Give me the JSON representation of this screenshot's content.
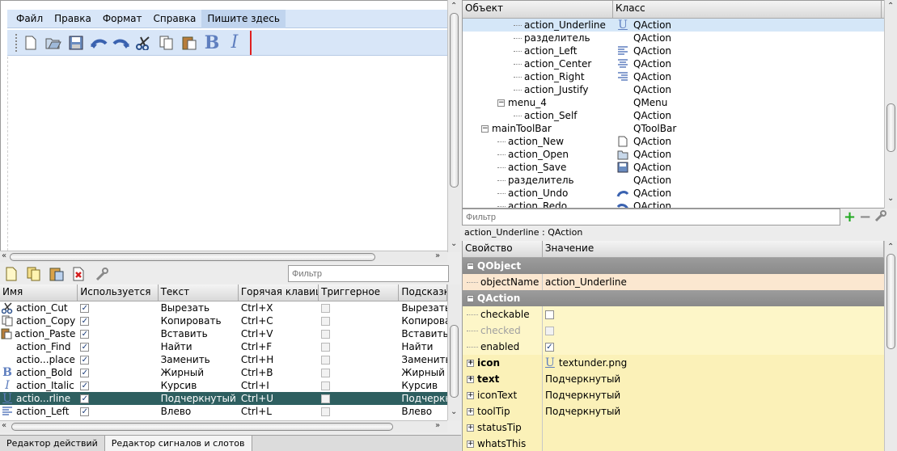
{
  "form": {
    "menu": [
      "Файл",
      "Правка",
      "Формат",
      "Справка",
      "Пишите здесь"
    ],
    "toolbar_icons": [
      "new-icon",
      "open-icon",
      "save-icon",
      "undo-icon",
      "redo-icon",
      "cut-icon",
      "copy-icon",
      "paste-icon",
      "bold-icon",
      "italic-icon"
    ]
  },
  "action_editor": {
    "filter_placeholder": "Фильтр",
    "toolbar_icons": [
      "new-action-icon",
      "copy-action-icon",
      "paste-action-icon",
      "delete-action-icon",
      "configure-icon"
    ],
    "columns": [
      "Имя",
      "Используется",
      "Текст",
      "Горячая клавиша",
      "Триггерное",
      "Подсказка"
    ],
    "rows": [
      {
        "icon": "cut-icon",
        "name": "action_Cut",
        "used": true,
        "text": "Вырезать",
        "shortcut": "Ctrl+X",
        "checkable": false,
        "tooltip": "Вырезать"
      },
      {
        "icon": "copy-icon",
        "name": "action_Copy",
        "used": true,
        "text": "Копировать",
        "shortcut": "Ctrl+C",
        "checkable": false,
        "tooltip": "Копировать"
      },
      {
        "icon": "paste-icon",
        "name": "action_Paste",
        "used": true,
        "text": "Вставить",
        "shortcut": "Ctrl+V",
        "checkable": false,
        "tooltip": "Вставить"
      },
      {
        "icon": "",
        "name": "action_Find",
        "used": true,
        "text": "Найти",
        "shortcut": "Ctrl+F",
        "checkable": false,
        "tooltip": "Найти"
      },
      {
        "icon": "",
        "name": "actio...place",
        "used": true,
        "text": "Заменить",
        "shortcut": "Ctrl+H",
        "checkable": false,
        "tooltip": "Заменить"
      },
      {
        "icon": "bold-icon",
        "name": "action_Bold",
        "used": true,
        "text": "Жирный",
        "shortcut": "Ctrl+B",
        "checkable": false,
        "tooltip": "Жирный"
      },
      {
        "icon": "italic-icon",
        "name": "action_Italic",
        "used": true,
        "text": "Курсив",
        "shortcut": "Ctrl+I",
        "checkable": false,
        "tooltip": "Курсив"
      },
      {
        "icon": "underline-icon",
        "name": "actio...rline",
        "used": true,
        "text": "Подчеркнутый",
        "shortcut": "Ctrl+U",
        "checkable": false,
        "tooltip": "Подчеркн",
        "selected": true
      },
      {
        "icon": "align-left-icon",
        "name": "action_Left",
        "used": true,
        "text": "Влево",
        "shortcut": "Ctrl+L",
        "checkable": false,
        "tooltip": "Влево"
      }
    ]
  },
  "tabs": [
    "Редактор действий",
    "Редактор сигналов и слотов"
  ],
  "object_inspector": {
    "columns": [
      "Объект",
      "Класс"
    ],
    "rows": [
      {
        "indent": 3,
        "name": "action_Underline",
        "class": "QAction",
        "icon": "underline-icon",
        "selected": true
      },
      {
        "indent": 3,
        "name": "разделитель",
        "class": "QAction",
        "icon": ""
      },
      {
        "indent": 3,
        "name": "action_Left",
        "class": "QAction",
        "icon": "align-left-icon"
      },
      {
        "indent": 3,
        "name": "action_Center",
        "class": "QAction",
        "icon": "align-center-icon"
      },
      {
        "indent": 3,
        "name": "action_Right",
        "class": "QAction",
        "icon": "align-right-icon"
      },
      {
        "indent": 3,
        "name": "action_Justify",
        "class": "QAction",
        "icon": ""
      },
      {
        "indent": 2,
        "name": "menu_4",
        "class": "QMenu",
        "icon": "",
        "toggle": "−"
      },
      {
        "indent": 3,
        "name": "action_Self",
        "class": "QAction",
        "icon": ""
      },
      {
        "indent": 1,
        "name": "mainToolBar",
        "class": "QToolBar",
        "icon": "",
        "toggle": "−"
      },
      {
        "indent": 2,
        "name": "action_New",
        "class": "QAction",
        "icon": "new-icon"
      },
      {
        "indent": 2,
        "name": "action_Open",
        "class": "QAction",
        "icon": "open-icon"
      },
      {
        "indent": 2,
        "name": "action_Save",
        "class": "QAction",
        "icon": "save-icon"
      },
      {
        "indent": 2,
        "name": "разделитель",
        "class": "QAction",
        "icon": ""
      },
      {
        "indent": 2,
        "name": "action_Undo",
        "class": "QAction",
        "icon": "undo-icon"
      },
      {
        "indent": 2,
        "name": "action_Redo",
        "class": "QAction",
        "icon": "redo-icon"
      }
    ]
  },
  "property_editor": {
    "filter_placeholder": "Фильтр",
    "object_label": "action_Underline : QAction",
    "columns": [
      "Свойство",
      "Значение"
    ],
    "rows": [
      {
        "type": "group",
        "label": "QObject"
      },
      {
        "type": "prop",
        "bg": "orange",
        "key": "objectName",
        "value": "action_Underline"
      },
      {
        "type": "group",
        "label": "QAction"
      },
      {
        "type": "prop",
        "bg": "yellow",
        "key": "checkable",
        "checkbox": false
      },
      {
        "type": "prop",
        "bg": "yellow",
        "key": "checked",
        "checkbox": false,
        "disabled": true
      },
      {
        "type": "prop",
        "bg": "yellow",
        "key": "enabled",
        "checkbox": true
      },
      {
        "type": "prop",
        "bg": "yellow2",
        "key": "icon",
        "bold": true,
        "expand": true,
        "value": "textunder.png",
        "icon": "underline-icon"
      },
      {
        "type": "prop",
        "bg": "yellow2",
        "key": "text",
        "bold": true,
        "expand": true,
        "value": "Подчеркнутый"
      },
      {
        "type": "prop",
        "bg": "yellow2",
        "key": "iconText",
        "expand": true,
        "value": "Подчеркнутый"
      },
      {
        "type": "prop",
        "bg": "yellow2",
        "key": "toolTip",
        "expand": true,
        "value": "Подчеркнутый"
      },
      {
        "type": "prop",
        "bg": "yellow2",
        "key": "statusTip",
        "expand": true,
        "value": ""
      },
      {
        "type": "prop",
        "bg": "yellow2",
        "key": "whatsThis",
        "expand": true,
        "value": ""
      }
    ]
  }
}
